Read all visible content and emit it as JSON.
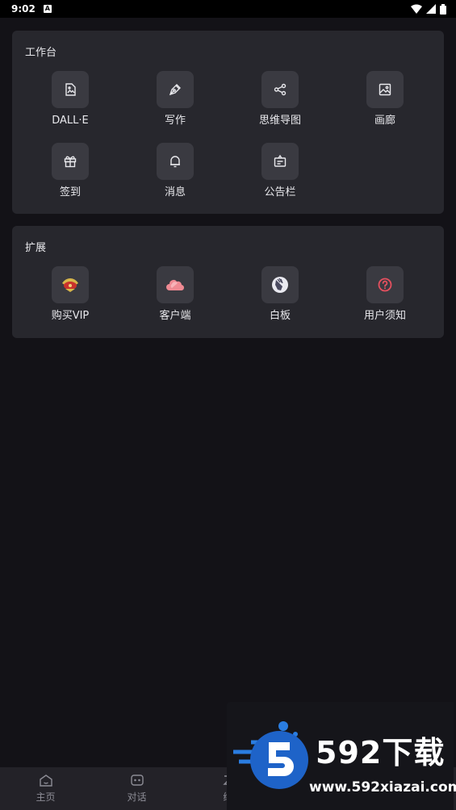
{
  "status": {
    "time": "9:02"
  },
  "workbench": {
    "title": "工作台",
    "items": [
      {
        "label": "DALL·E",
        "icon": "image-icon"
      },
      {
        "label": "写作",
        "icon": "pen-icon"
      },
      {
        "label": "思维导图",
        "icon": "share-icon"
      },
      {
        "label": "画廊",
        "icon": "gallery-icon"
      },
      {
        "label": "签到",
        "icon": "gift-icon"
      },
      {
        "label": "消息",
        "icon": "bell-icon"
      },
      {
        "label": "公告栏",
        "icon": "board-icon"
      }
    ]
  },
  "extensions": {
    "title": "扩展",
    "items": [
      {
        "label": "购买VIP",
        "icon": "vip-badge-icon"
      },
      {
        "label": "客户端",
        "icon": "cloud-icon"
      },
      {
        "label": "白板",
        "icon": "whiteboard-icon"
      },
      {
        "label": "用户须知",
        "icon": "question-icon"
      }
    ]
  },
  "nav": {
    "items": [
      {
        "label": "主页",
        "icon": "home-icon"
      },
      {
        "label": "对话",
        "icon": "chat-icon"
      },
      {
        "label": "绘",
        "icon": "draw-icon"
      }
    ]
  },
  "watermark": {
    "brand": "592下载",
    "url": "www.592xiazai.com"
  },
  "colors": {
    "background": "#131217",
    "card": "#27272d",
    "icon_box": "#3a3a41",
    "nav": "#232228"
  }
}
